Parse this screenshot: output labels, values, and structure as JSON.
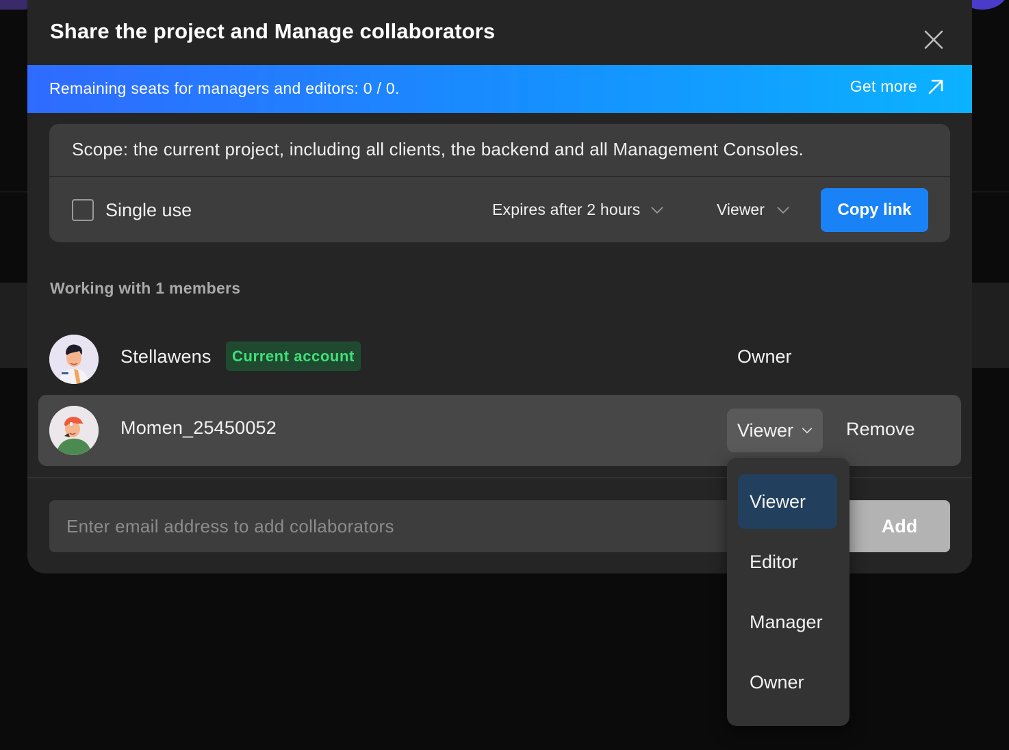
{
  "modal": {
    "title": "Share the project and Manage collaborators"
  },
  "banner": {
    "text": "Remaining seats for managers and editors: 0 / 0.",
    "link_label": "Get more"
  },
  "share_settings": {
    "scope_text": "Scope: the current project, including all clients, the backend and all Management Consoles.",
    "single_use_label": "Single use",
    "single_use_checked": false,
    "expires_label": "Expires after 2 hours",
    "role_label": "Viewer",
    "copy_link_label": "Copy link"
  },
  "members": {
    "heading": "Working with 1 members",
    "list": [
      {
        "name": "Stellawens",
        "badge": "Current account",
        "role": "Owner",
        "avatar": "avatar-man-dark-hair"
      },
      {
        "name": "Momen_25450052",
        "role": "Viewer",
        "action": "Remove",
        "avatar": "avatar-man-orange-cap"
      }
    ]
  },
  "add_collaborator": {
    "placeholder": "Enter email address to add collaborators",
    "button_label": "Add"
  },
  "role_menu": {
    "selected": "Viewer",
    "options": [
      "Viewer",
      "Editor",
      "Manager",
      "Owner"
    ]
  },
  "colors": {
    "accent": "#1a82f7",
    "banner_start": "#2f6bff",
    "banner_end": "#0bb2ff",
    "badge_text": "#3fe07a",
    "badge_bg": "#1f4a30",
    "menu_selected": "#22405e"
  }
}
